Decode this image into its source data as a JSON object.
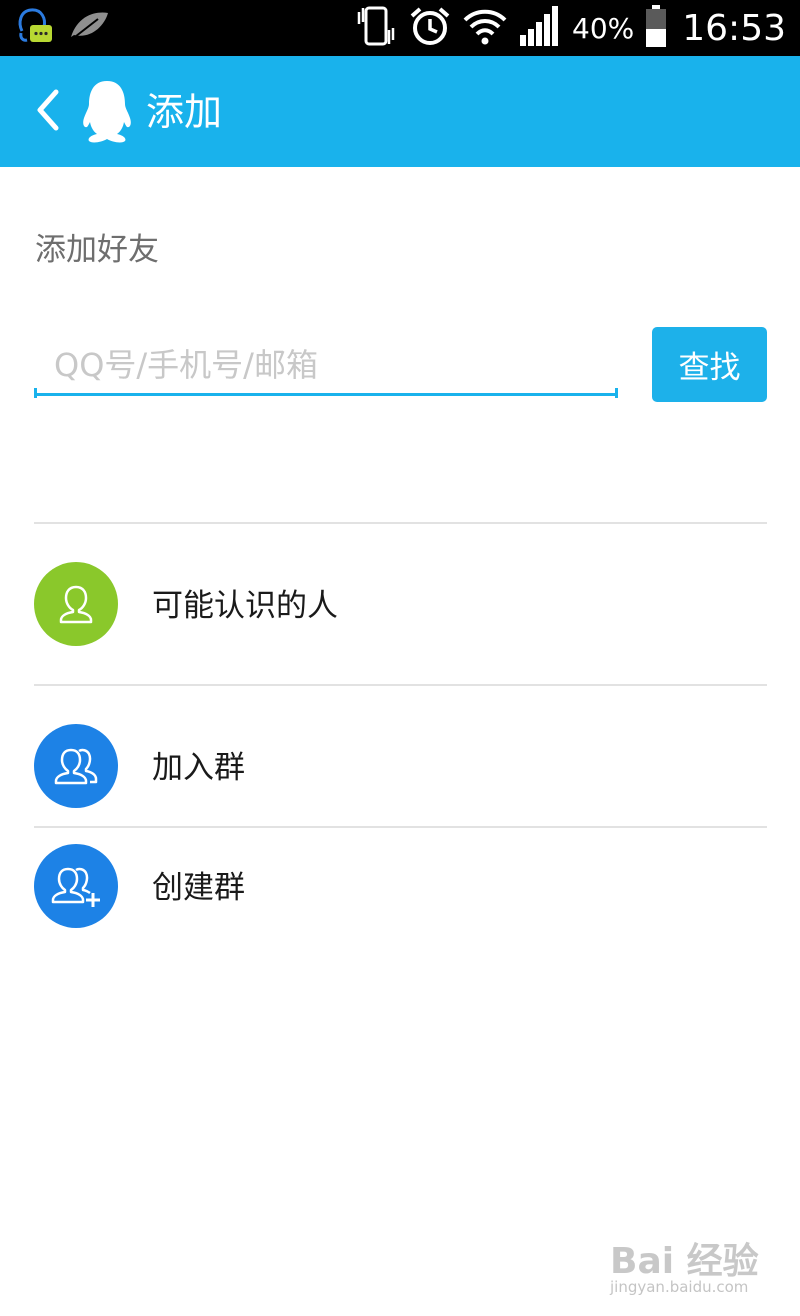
{
  "status_bar": {
    "battery": "40%",
    "time": "16:53",
    "icons": [
      "qq-notification-icon",
      "leaf-icon",
      "vibrate-icon",
      "alarm-icon",
      "wifi-icon",
      "signal-icon",
      "battery-icon"
    ]
  },
  "title_bar": {
    "title": "添加",
    "icons": [
      "back-arrow-icon",
      "qq-penguin-icon"
    ]
  },
  "add_friend": {
    "heading": "添加好友",
    "search_placeholder": "QQ号/手机号/邮箱",
    "search_value": "",
    "find_label": "查找"
  },
  "options": [
    {
      "label": "可能认识的人",
      "icon": "person-icon",
      "color": "#8ac82b"
    },
    {
      "label": "加入群",
      "icon": "group-icon",
      "color": "#1d82e6"
    },
    {
      "label": "创建群",
      "icon": "group-add-icon",
      "color": "#1d82e6"
    }
  ],
  "watermark": {
    "brand": "Bai 经验",
    "url": "jingyan.baidu.com"
  },
  "colors": {
    "accent": "#19b2ec",
    "button": "#1db1ea",
    "green_icon": "#8ac82b",
    "blue_icon": "#1d82e6"
  }
}
